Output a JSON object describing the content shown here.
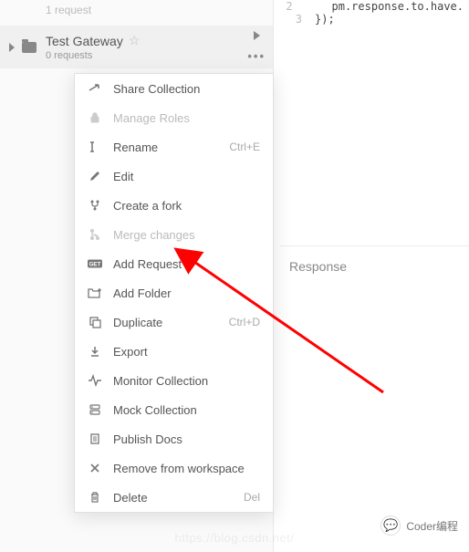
{
  "sidebar": {
    "prev_item_sub": "1 request",
    "collection": {
      "title": "Test Gateway",
      "sub": "0 requests"
    }
  },
  "menu": {
    "share": "Share Collection",
    "manage_roles": "Manage Roles",
    "rename": "Rename",
    "rename_shortcut": "Ctrl+E",
    "edit": "Edit",
    "fork": "Create a fork",
    "merge": "Merge changes",
    "add_request": "Add Request",
    "add_folder": "Add Folder",
    "duplicate": "Duplicate",
    "duplicate_shortcut": "Ctrl+D",
    "export": "Export",
    "monitor": "Monitor Collection",
    "mock": "Mock Collection",
    "publish": "Publish Docs",
    "remove": "Remove from workspace",
    "delete": "Delete",
    "delete_shortcut": "Del"
  },
  "code": {
    "lines": [
      {
        "num": "2",
        "text": "    pm.response.to.have."
      },
      {
        "num": "3",
        "text": "});"
      }
    ]
  },
  "response_label": "Response",
  "watermark_text": "Coder编程",
  "faint_url": "https://blog.csdn.net/"
}
